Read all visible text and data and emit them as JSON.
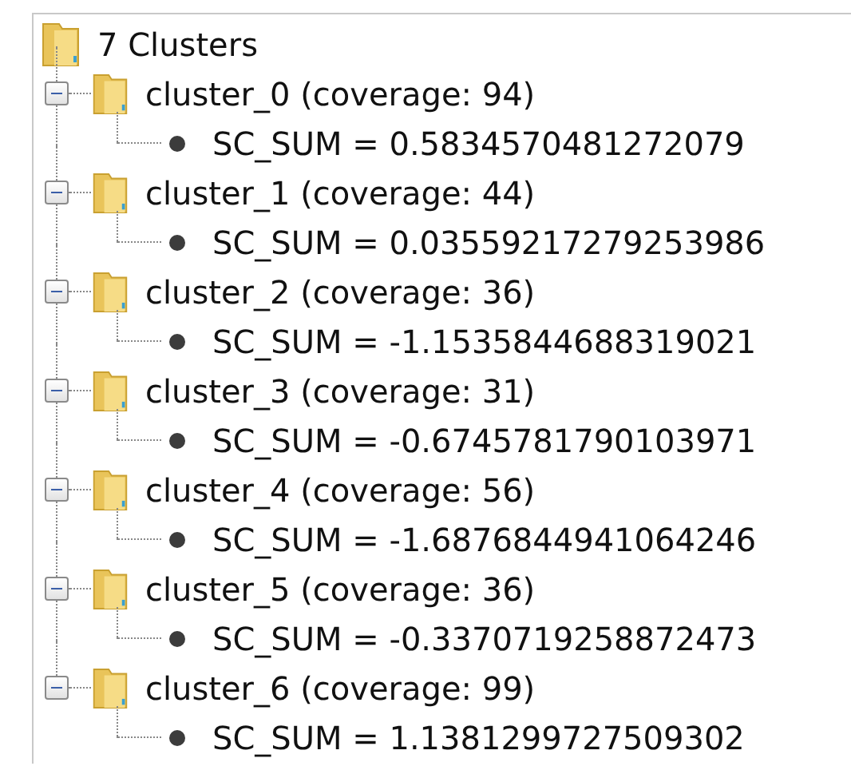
{
  "tree": {
    "label": "7 Clusters",
    "children": [
      {
        "label": "cluster_0 (coverage: 94)",
        "expanded": true,
        "children": [
          {
            "label": "SC_SUM = 0.5834570481272079"
          }
        ]
      },
      {
        "label": "cluster_1 (coverage: 44)",
        "expanded": true,
        "children": [
          {
            "label": "SC_SUM = 0.03559217279253986"
          }
        ]
      },
      {
        "label": "cluster_2 (coverage: 36)",
        "expanded": true,
        "children": [
          {
            "label": "SC_SUM = -1.1535844688319021"
          }
        ]
      },
      {
        "label": "cluster_3 (coverage: 31)",
        "expanded": true,
        "children": [
          {
            "label": "SC_SUM = -0.6745781790103971"
          }
        ]
      },
      {
        "label": "cluster_4 (coverage: 56)",
        "expanded": true,
        "children": [
          {
            "label": "SC_SUM = -1.6876844941064246"
          }
        ]
      },
      {
        "label": "cluster_5 (coverage: 36)",
        "expanded": true,
        "children": [
          {
            "label": "SC_SUM = -0.3370719258872473"
          }
        ]
      },
      {
        "label": "cluster_6 (coverage: 99)",
        "expanded": true,
        "children": [
          {
            "label": "SC_SUM = 1.1381299727509302"
          }
        ]
      }
    ]
  }
}
